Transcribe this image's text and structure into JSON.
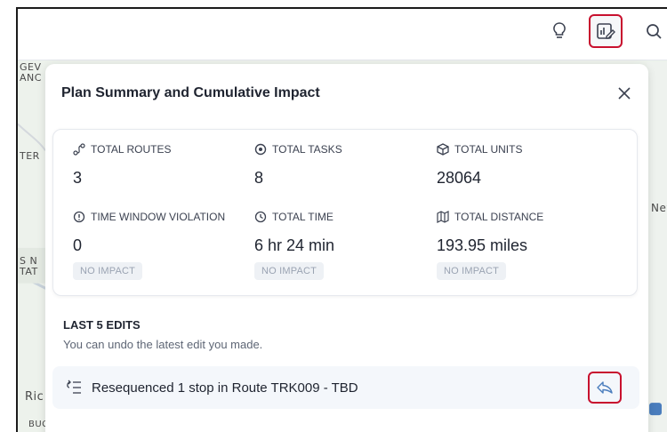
{
  "toolbar": {
    "icons": [
      "lightbulb-icon",
      "report-edit-icon",
      "search-icon"
    ]
  },
  "map": {
    "labels": [
      "GEV\nANC",
      "TER",
      "S N\nTAT",
      "Ric",
      "BUCKINGHAM",
      "Nev"
    ]
  },
  "panel": {
    "title": "Plan Summary and Cumulative Impact",
    "stats": [
      {
        "label": "TOTAL ROUTES",
        "value": "3",
        "icon": "route-icon"
      },
      {
        "label": "TOTAL TASKS",
        "value": "8",
        "icon": "target-icon"
      },
      {
        "label": "TOTAL UNITS",
        "value": "28064",
        "icon": "box-icon"
      },
      {
        "label": "TIME WINDOW VIOLATION",
        "value": "0",
        "icon": "alert-circle-icon",
        "badge": "NO IMPACT"
      },
      {
        "label": "TOTAL TIME",
        "value": "6 hr 24 min",
        "icon": "clock-icon",
        "badge": "NO IMPACT"
      },
      {
        "label": "TOTAL DISTANCE",
        "value": "193.95 miles",
        "icon": "map-icon",
        "badge": "NO IMPACT"
      }
    ],
    "edits": {
      "title": "LAST 5 EDITS",
      "subtitle": "You can undo the latest edit you made.",
      "items": [
        {
          "text": "Resequenced 1 stop in Route TRK009 - TBD"
        }
      ]
    }
  },
  "colors": {
    "highlight": "#c8102e",
    "text": "#1f2430",
    "badge_bg": "#eef1f5",
    "badge_text": "#9aa3b2",
    "edit_row_bg": "#f4f7fb"
  }
}
